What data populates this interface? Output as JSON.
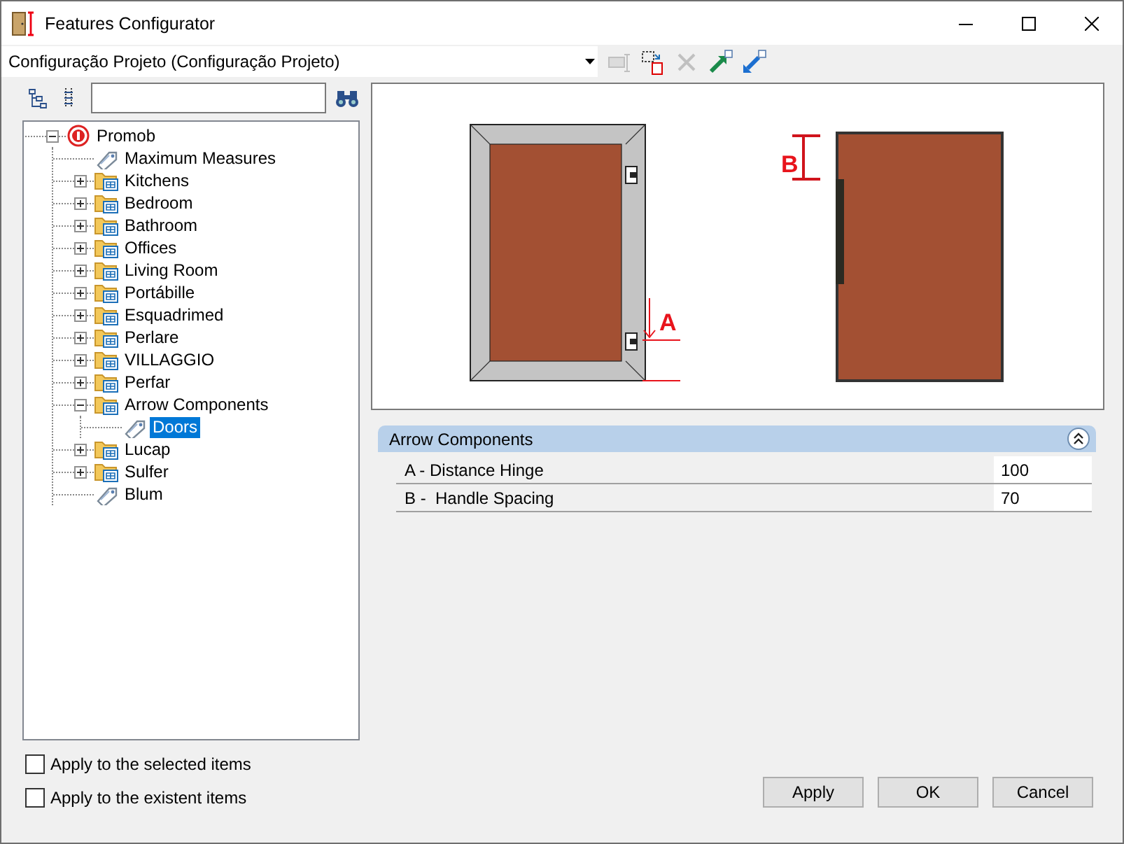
{
  "window": {
    "title": "Features Configurator"
  },
  "configuration": {
    "value": "Configuração Projeto (Configuração Projeto)"
  },
  "toolbar": [
    {
      "kind": "rename",
      "disabled": true
    },
    {
      "kind": "copy",
      "disabled": false
    },
    {
      "kind": "delete",
      "disabled": true
    },
    {
      "kind": "export",
      "disabled": false
    },
    {
      "kind": "import",
      "disabled": false
    }
  ],
  "tree": [
    {
      "label": "Promob",
      "kind": "root",
      "expanded": true,
      "selected": false,
      "children": [
        {
          "label": "Maximum Measures",
          "kind": "tag",
          "selected": false
        },
        {
          "label": "Kitchens",
          "kind": "folder",
          "expanded": false,
          "selected": false
        },
        {
          "label": "Bedroom",
          "kind": "folder",
          "expanded": false,
          "selected": false
        },
        {
          "label": "Bathroom",
          "kind": "folder",
          "expanded": false,
          "selected": false
        },
        {
          "label": "Offices",
          "kind": "folder",
          "expanded": false,
          "selected": false
        },
        {
          "label": "Living Room",
          "kind": "folder",
          "expanded": false,
          "selected": false
        },
        {
          "label": "Portábille",
          "kind": "folder",
          "expanded": false,
          "selected": false
        },
        {
          "label": "Esquadrimed",
          "kind": "folder",
          "expanded": false,
          "selected": false
        },
        {
          "label": "Perlare",
          "kind": "folder",
          "expanded": false,
          "selected": false
        },
        {
          "label": "VILLAGGIO",
          "kind": "folder",
          "expanded": false,
          "selected": false
        },
        {
          "label": "Perfar",
          "kind": "folder",
          "expanded": false,
          "selected": false
        },
        {
          "label": "Arrow Components",
          "kind": "folder",
          "expanded": true,
          "selected": false,
          "children": [
            {
              "label": "Doors",
              "kind": "tag",
              "selected": true
            }
          ]
        },
        {
          "label": "Lucap",
          "kind": "folder",
          "expanded": false,
          "selected": false
        },
        {
          "label": "Sulfer",
          "kind": "folder",
          "expanded": false,
          "selected": false
        },
        {
          "label": "Blum",
          "kind": "tag",
          "selected": false
        }
      ]
    }
  ],
  "preview": {
    "hinge_label": "A",
    "handle_label": "B"
  },
  "properties": {
    "title": "Arrow Components",
    "expanded": true,
    "rows": [
      {
        "name": "A - Distance Hinge",
        "value": "100"
      },
      {
        "name": "B -  Handle Spacing",
        "value": "70"
      }
    ]
  },
  "options": [
    {
      "label": "Apply to the selected items",
      "checked": false
    },
    {
      "label": "Apply to the existent items",
      "checked": false
    }
  ],
  "buttons": [
    "Apply",
    "OK",
    "Cancel"
  ]
}
